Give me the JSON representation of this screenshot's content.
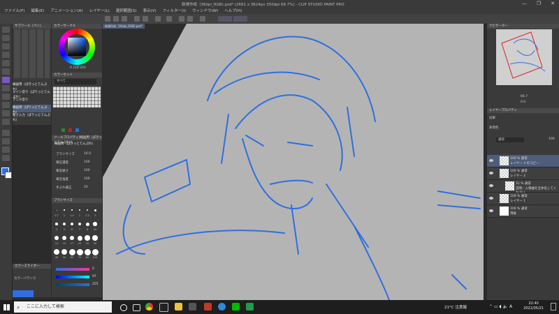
{
  "window": {
    "title": "新規作成（36dpi_RGB).psd* (2691 x 3624px 350dpi 66.7%) - CLIP STUDIO PAINT PRO",
    "controls": [
      "—",
      "❐",
      "✕"
    ]
  },
  "menu": [
    "ファイル(F)",
    "編集(E)",
    "アニメーション(A)",
    "レイヤー(L)",
    "選択範囲(S)",
    "表示(V)",
    "フィルター(I)",
    "ウィンドウ(W)",
    "ヘルプ(H)"
  ],
  "document_tab": "新規作成（36dpi_RGB).psd*",
  "sub_tool": {
    "title": "サブツール［ペン］",
    "brushes": [
      "線画用（ぱきっとてんぷれ）",
      "メイン塗り（ぱりっとてんぷれ）",
      "アニメ塗り",
      "線画用（ぱりっとてんぷれ）",
      "粗さ入力（ぱりっとてんぷれ）"
    ]
  },
  "color_wheel": {
    "title": "カラーサークル",
    "value_h": "",
    "readout": "0  218  255"
  },
  "color_set": {
    "title": "カラーセット",
    "set_name": "すべて"
  },
  "tool_property": {
    "title": "ツールプロパティ[線画用（ぱきっとてんぷれ）]",
    "brush_name": "線画用（ぱきっとてんぷれ）",
    "rows": [
      {
        "label": "ブラシサイズ",
        "value": "16.0"
      },
      {
        "label": "筆圧濃度",
        "value": "100"
      },
      {
        "label": "筆圧硬さ",
        "value": "100"
      },
      {
        "label": "筆圧強度",
        "value": "100"
      },
      {
        "label": "手ぶれ補正",
        "value": "20"
      },
      {
        "label": "ベクター吸着",
        "value": ""
      }
    ]
  },
  "brush_size": {
    "title": "ブラシサイズ",
    "sizes": [
      "0.7",
      "1",
      "1.5",
      "2",
      "2.5",
      "3",
      "4",
      "5",
      "6",
      "7",
      "8",
      "10",
      "12",
      "15",
      "17",
      "20",
      "25",
      "30",
      "40",
      "50",
      "60",
      "70",
      "80",
      "100"
    ]
  },
  "color_history": {
    "title": "カラースライダー",
    "items": [
      "カラーバランス"
    ]
  },
  "sliders": {
    "values": [
      "0",
      "97",
      "255"
    ]
  },
  "navigator": {
    "title": "ナビゲーター",
    "zoom": "66.7",
    "rotate": "0.0"
  },
  "layer_panel": {
    "title": "レイヤープロパティ",
    "effect_label": "効果",
    "expression_label": "表現色",
    "blend_mode": "通常",
    "opacity": "100",
    "layers": [
      {
        "mode": "100 % 通常",
        "name": "レイヤー 3 のコピー",
        "selected": true
      },
      {
        "mode": "100 % 通常",
        "name": "レイヤー 2",
        "selected": false
      },
      {
        "mode": "31 % 通常",
        "name": "説明：入場曲を全体化してください",
        "selected": false
      },
      {
        "mode": "100 % 通常",
        "name": "レイヤー 1",
        "selected": false
      },
      {
        "mode": "100 % 通常",
        "name": "用紙",
        "selected": false
      }
    ]
  },
  "taskbar": {
    "search_placeholder": "ここに入力して検索",
    "weather": "21°C 注意報",
    "time": "22:40",
    "date": "2021/05/21"
  },
  "colors": {
    "accent": "#3f73d8",
    "panel": "#3a3a3a",
    "canvas_gray": "#b4b4b4",
    "sketch": "#2f6ee0"
  }
}
